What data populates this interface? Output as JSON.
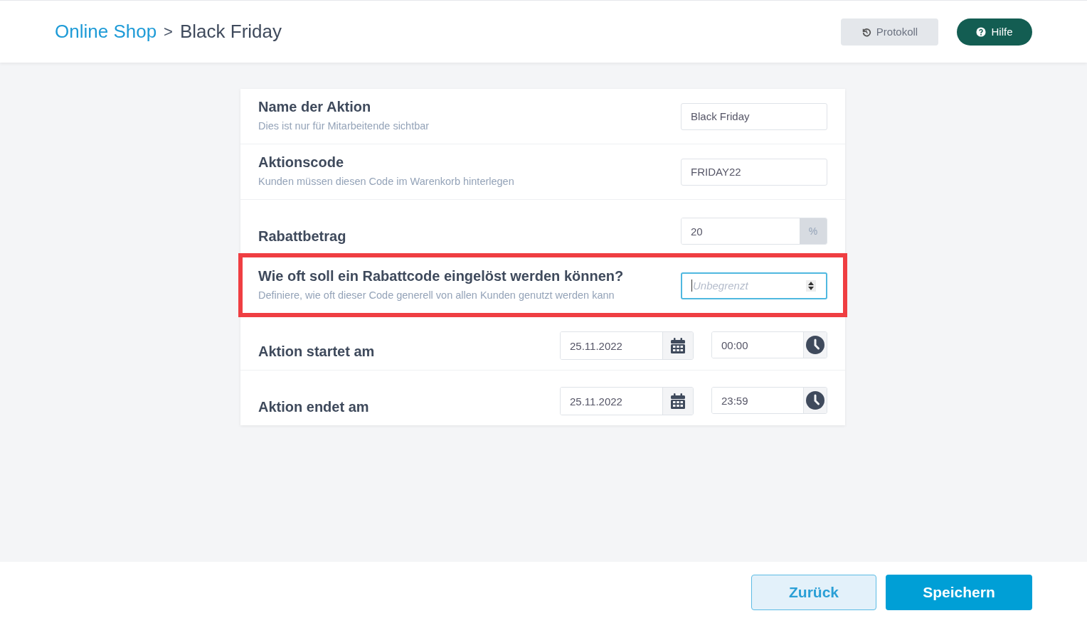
{
  "breadcrumb": {
    "parent": "Online Shop",
    "separator": ">",
    "current": "Black Friday"
  },
  "header_buttons": [
    {
      "kind": "history",
      "label": "Protokoll"
    },
    {
      "kind": "help",
      "label": "Hilfe"
    }
  ],
  "rows": [
    {
      "kind": "text",
      "title": "Name der Aktion",
      "hint": "Dies ist nur für Mitarbeitende sichtbar",
      "value": "Black Friday",
      "highlighted": false
    },
    {
      "kind": "text",
      "title": "Aktionscode",
      "hint": "Kunden müssen diesen Code im Warenkorb hinterlegen",
      "value": "FRIDAY22",
      "highlighted": false
    },
    {
      "kind": "suffix",
      "title": "Rabattbetrag",
      "value": "20",
      "suffix": "%",
      "highlighted": false
    },
    {
      "kind": "number",
      "title": "Wie oft soll ein Rabattcode eingelöst werden können?",
      "hint": "Definiere, wie oft dieser Code generell von allen Kunden genutzt werden kann",
      "placeholder": "Unbegrenzt",
      "focused": true,
      "highlighted": true
    },
    {
      "kind": "datetime",
      "title": "Aktion startet am",
      "date": "25.11.2022",
      "time": "00:00",
      "highlighted": false
    },
    {
      "kind": "datetime",
      "title": "Aktion endet am",
      "date": "25.11.2022",
      "time": "23:59",
      "highlighted": false
    }
  ],
  "footer_buttons": [
    {
      "kind": "secondary",
      "label": "Zurück"
    },
    {
      "kind": "primary",
      "label": "Speichern"
    }
  ]
}
